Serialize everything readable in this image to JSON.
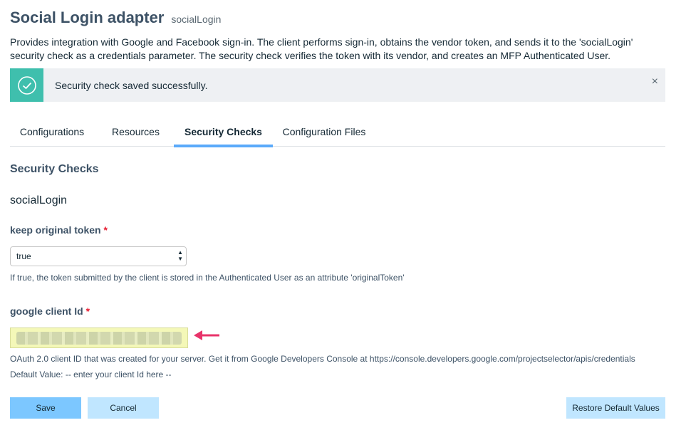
{
  "header": {
    "title": "Social Login adapter",
    "subtitle": "socialLogin"
  },
  "description": "Provides integration with Google and Facebook sign-in. The client performs sign-in, obtains the vendor token, and sends it to the 'socialLogin' security check as a credentials parameter. The security check verifies the token with its vendor, and creates an MFP Authenticated User.",
  "notification": {
    "message": "Security check saved successfully.",
    "close_label": "×",
    "icon": "checkmark-circle-icon",
    "icon_color": "#3fbfad"
  },
  "tabs": [
    {
      "label": "Configurations"
    },
    {
      "label": "Resources"
    },
    {
      "label": "Security Checks",
      "active": true
    },
    {
      "label": "Configuration Files"
    }
  ],
  "section_title": "Security Checks",
  "security_check_name": "socialLogin",
  "fields": {
    "keep_original_token": {
      "label": "keep original token",
      "required_marker": "*",
      "value": "true",
      "help": "If true, the token submitted by the client is stored in the Authenticated User as an attribute 'originalToken'"
    },
    "google_client_id": {
      "label": "google client Id",
      "required_marker": "*",
      "help": "OAuth 2.0 client ID that was created for your server. Get it from Google Developers Console at https://console.developers.google.com/projectselector/apis/credentials",
      "default_value": "Default Value: -- enter your client Id here --"
    }
  },
  "buttons": {
    "save": "Save",
    "cancel": "Cancel",
    "restore": "Restore Default Values"
  },
  "colors": {
    "accent": "#5aaafa",
    "primary_button": "#7cc7ff",
    "secondary_button": "#c0e6ff",
    "required": "#e71d32",
    "annotation_arrow": "#e8336a"
  }
}
